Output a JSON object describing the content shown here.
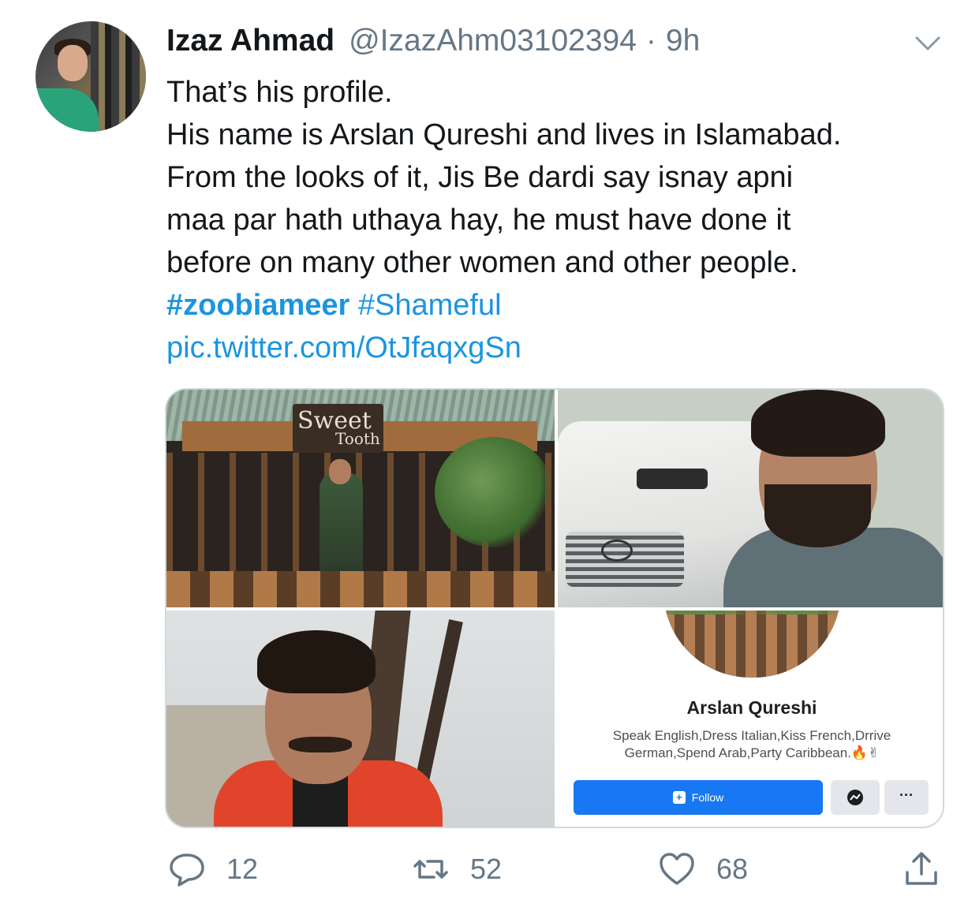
{
  "tweet": {
    "author_name": "Izaz Ahmad",
    "handle": "@IzazAhm03102394",
    "separator": "·",
    "time": "9h",
    "lines": [
      "That’s his profile.",
      "His name is Arslan Qureshi and lives in Islamabad.",
      "From the looks of it, Jis Be dardi say isnay apni",
      "maa par hath uthaya hay, he must have done it",
      "before on many other women and other people."
    ],
    "hashtags": [
      "#zoobiameer",
      "#Shameful"
    ],
    "link": "pic.twitter.com/OtJfaqxgSn"
  },
  "media": {
    "shop_sign_line1": "Sweet",
    "shop_sign_line2": "Tooth",
    "profile_name": "Arslan Qureshi",
    "profile_bio_line1": "Speak English,Dress Italian,Kiss French,Drrive",
    "profile_bio_line2": "German,Spend Arab,Party Caribbean.🔥✌",
    "follow_label": "Follow",
    "more_label": "···"
  },
  "actions": {
    "replies": "12",
    "retweets": "52",
    "likes": "68"
  },
  "icons": {
    "reply": "reply-icon",
    "retweet": "retweet-icon",
    "like": "heart-icon",
    "share": "share-icon",
    "menu": "chevron-down-icon",
    "messenger": "messenger-icon"
  },
  "colors": {
    "link": "#1b95e0",
    "muted": "#657786",
    "fb_blue": "#1877f2"
  }
}
